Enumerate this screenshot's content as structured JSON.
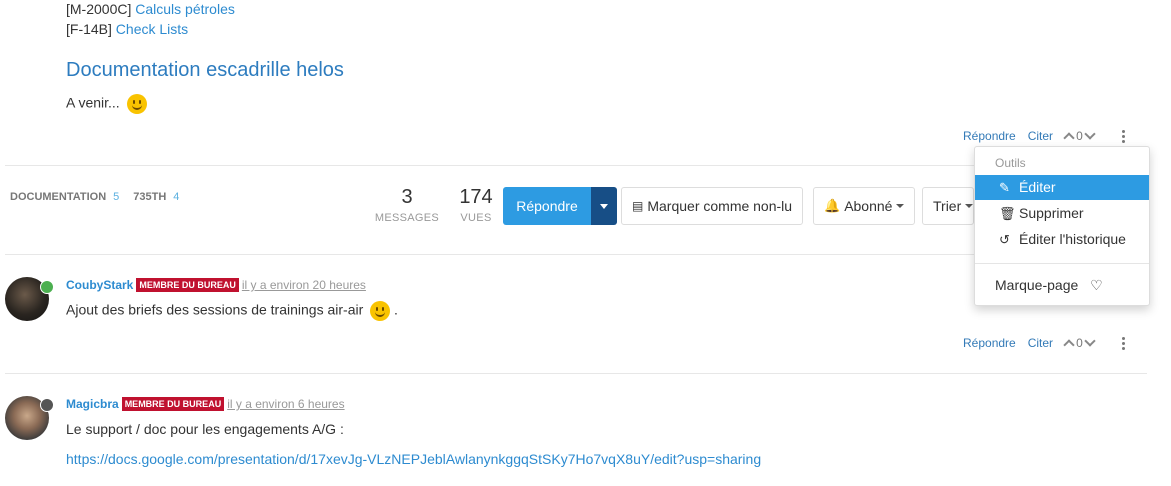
{
  "refs": [
    {
      "prefix": "[M-2000C]",
      "link": "Calculs pétroles"
    },
    {
      "prefix": "[F-14B]",
      "link": "Check Lists"
    }
  ],
  "section_title": "Documentation escadrille helos",
  "section_text": "A venir...",
  "post_tools": {
    "reply": "Répondre",
    "quote": "Citer",
    "votes": "0"
  },
  "tags": [
    {
      "name": "DOCUMENTATION",
      "count": "5"
    },
    {
      "name": "735TH",
      "count": "4"
    }
  ],
  "stats": {
    "messages": {
      "value": "3",
      "label": "MESSAGES"
    },
    "views": {
      "value": "174",
      "label": "VUES"
    }
  },
  "toolbar": {
    "reply": "Répondre",
    "mark_unread": "Marquer comme non-lu",
    "subscribed": "Abonné",
    "sort": "Trier"
  },
  "menu": {
    "header": "Outils",
    "items": [
      "Éditer",
      "Supprimer",
      "Éditer l'historique"
    ],
    "bookmark": "Marque-page"
  },
  "posts": [
    {
      "user": "CoubyStark",
      "badge": "MEMBRE DU BUREAU",
      "time": "il y a environ 20 heures",
      "text": "Ajout des briefs des sessions de trainings air-air",
      "status_color": "#4caf50"
    },
    {
      "user": "Magicbra",
      "badge": "MEMBRE DU BUREAU",
      "time": "il y a environ 6 heures",
      "text": "Le support / doc pour les engagements A/G :",
      "link": "https://docs.google.com/presentation/d/17xevJg-VLzNEPJeblAwlanynkggqStSKy7Ho7vqX8uY/edit?usp=sharing",
      "status_color": "#555555"
    }
  ],
  "colors": {
    "accent": "#2d9be2",
    "badge": "#c0112f",
    "dark_caret": "#174e86"
  }
}
